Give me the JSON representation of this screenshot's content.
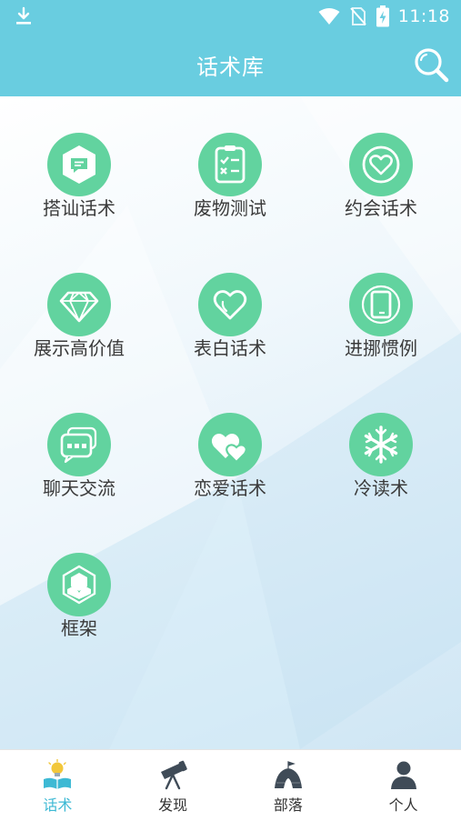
{
  "status_bar": {
    "time": "11:18"
  },
  "header": {
    "title": "话术库"
  },
  "grid": {
    "items": [
      {
        "label": "搭讪话术",
        "icon": "chat-bubble-icon"
      },
      {
        "label": "废物测试",
        "icon": "checklist-icon"
      },
      {
        "label": "约会话术",
        "icon": "heart-ring-icon"
      },
      {
        "label": "展示高价值",
        "icon": "diamond-icon"
      },
      {
        "label": "表白话术",
        "icon": "heart-hand-icon"
      },
      {
        "label": "进挪惯例",
        "icon": "phone-icon"
      },
      {
        "label": "聊天交流",
        "icon": "message-dots-icon"
      },
      {
        "label": "恋爱话术",
        "icon": "double-heart-icon"
      },
      {
        "label": "冷读术",
        "icon": "snowflake-icon"
      },
      {
        "label": "框架",
        "icon": "cube-icon"
      }
    ]
  },
  "tabbar": {
    "tabs": [
      {
        "label": "话术",
        "icon": "lightbulb-book-icon",
        "active": true
      },
      {
        "label": "发现",
        "icon": "telescope-icon",
        "active": false
      },
      {
        "label": "部落",
        "icon": "tent-icon",
        "active": false
      },
      {
        "label": "个人",
        "icon": "person-icon",
        "active": false
      }
    ]
  },
  "colors": {
    "header": "#69cde0",
    "icon_circle": "#62d39f",
    "active_tab": "#3db9d4"
  }
}
